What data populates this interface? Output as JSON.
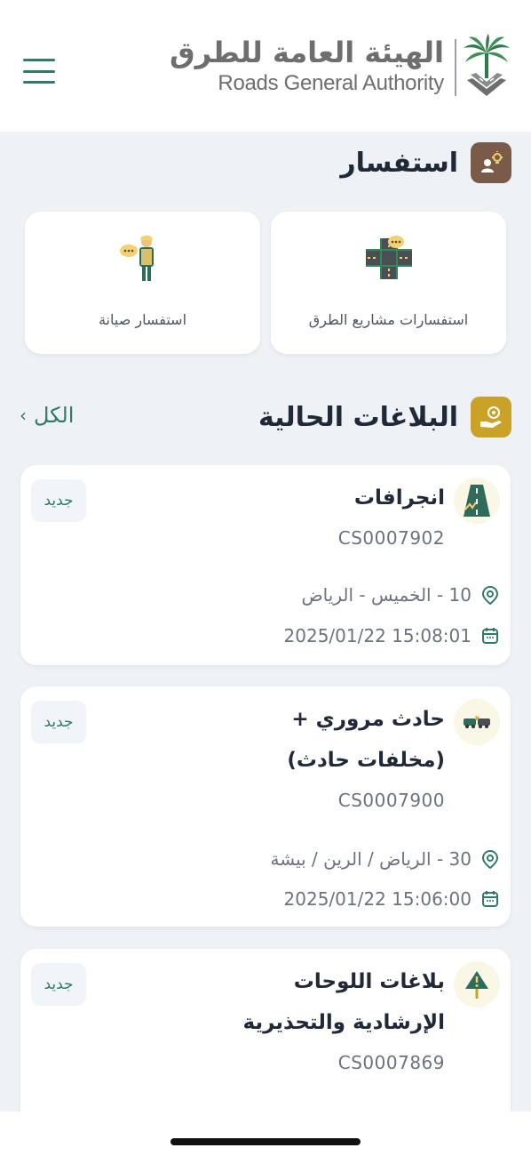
{
  "header": {
    "logo_arabic": "الهيئة العامة للطرق",
    "logo_english": "Roads General Authority"
  },
  "inquiry": {
    "title": "استفسار",
    "cards": [
      {
        "label": "استفسارات مشاريع الطرق",
        "icon": "road-crossing-icon"
      },
      {
        "label": "استفسار صيانة",
        "icon": "maintenance-worker-icon"
      }
    ]
  },
  "reports": {
    "title": "البلاغات الحالية",
    "see_all": "الكل",
    "items": [
      {
        "title_line1": "انجرافات",
        "title_line2": "",
        "number": "CS0007902",
        "location": "10 - الخميس - الرياض",
        "datetime": "15:08:01 2025/01/22",
        "status": "جديد",
        "icon": "road-erosion-icon"
      },
      {
        "title_line1": "حادث مروري +",
        "title_line2": "(مخلفات حادث)",
        "number": "CS0007900",
        "location": "30 - الرياض / الرين / بيشة",
        "datetime": "15:06:00 2025/01/22",
        "status": "جديد",
        "icon": "car-accident-icon"
      },
      {
        "title_line1": "بلاغات اللوحات",
        "title_line2": "الإرشادية والتحذيرية",
        "number": "CS0007869",
        "status": "جديد",
        "icon": "warning-sign-icon"
      }
    ]
  },
  "colors": {
    "brand_green": "#2f7a6a",
    "inquiry_icon_bg": "#7a5a48",
    "reports_icon_bg": "#c9a227",
    "background": "#eef2f7"
  }
}
